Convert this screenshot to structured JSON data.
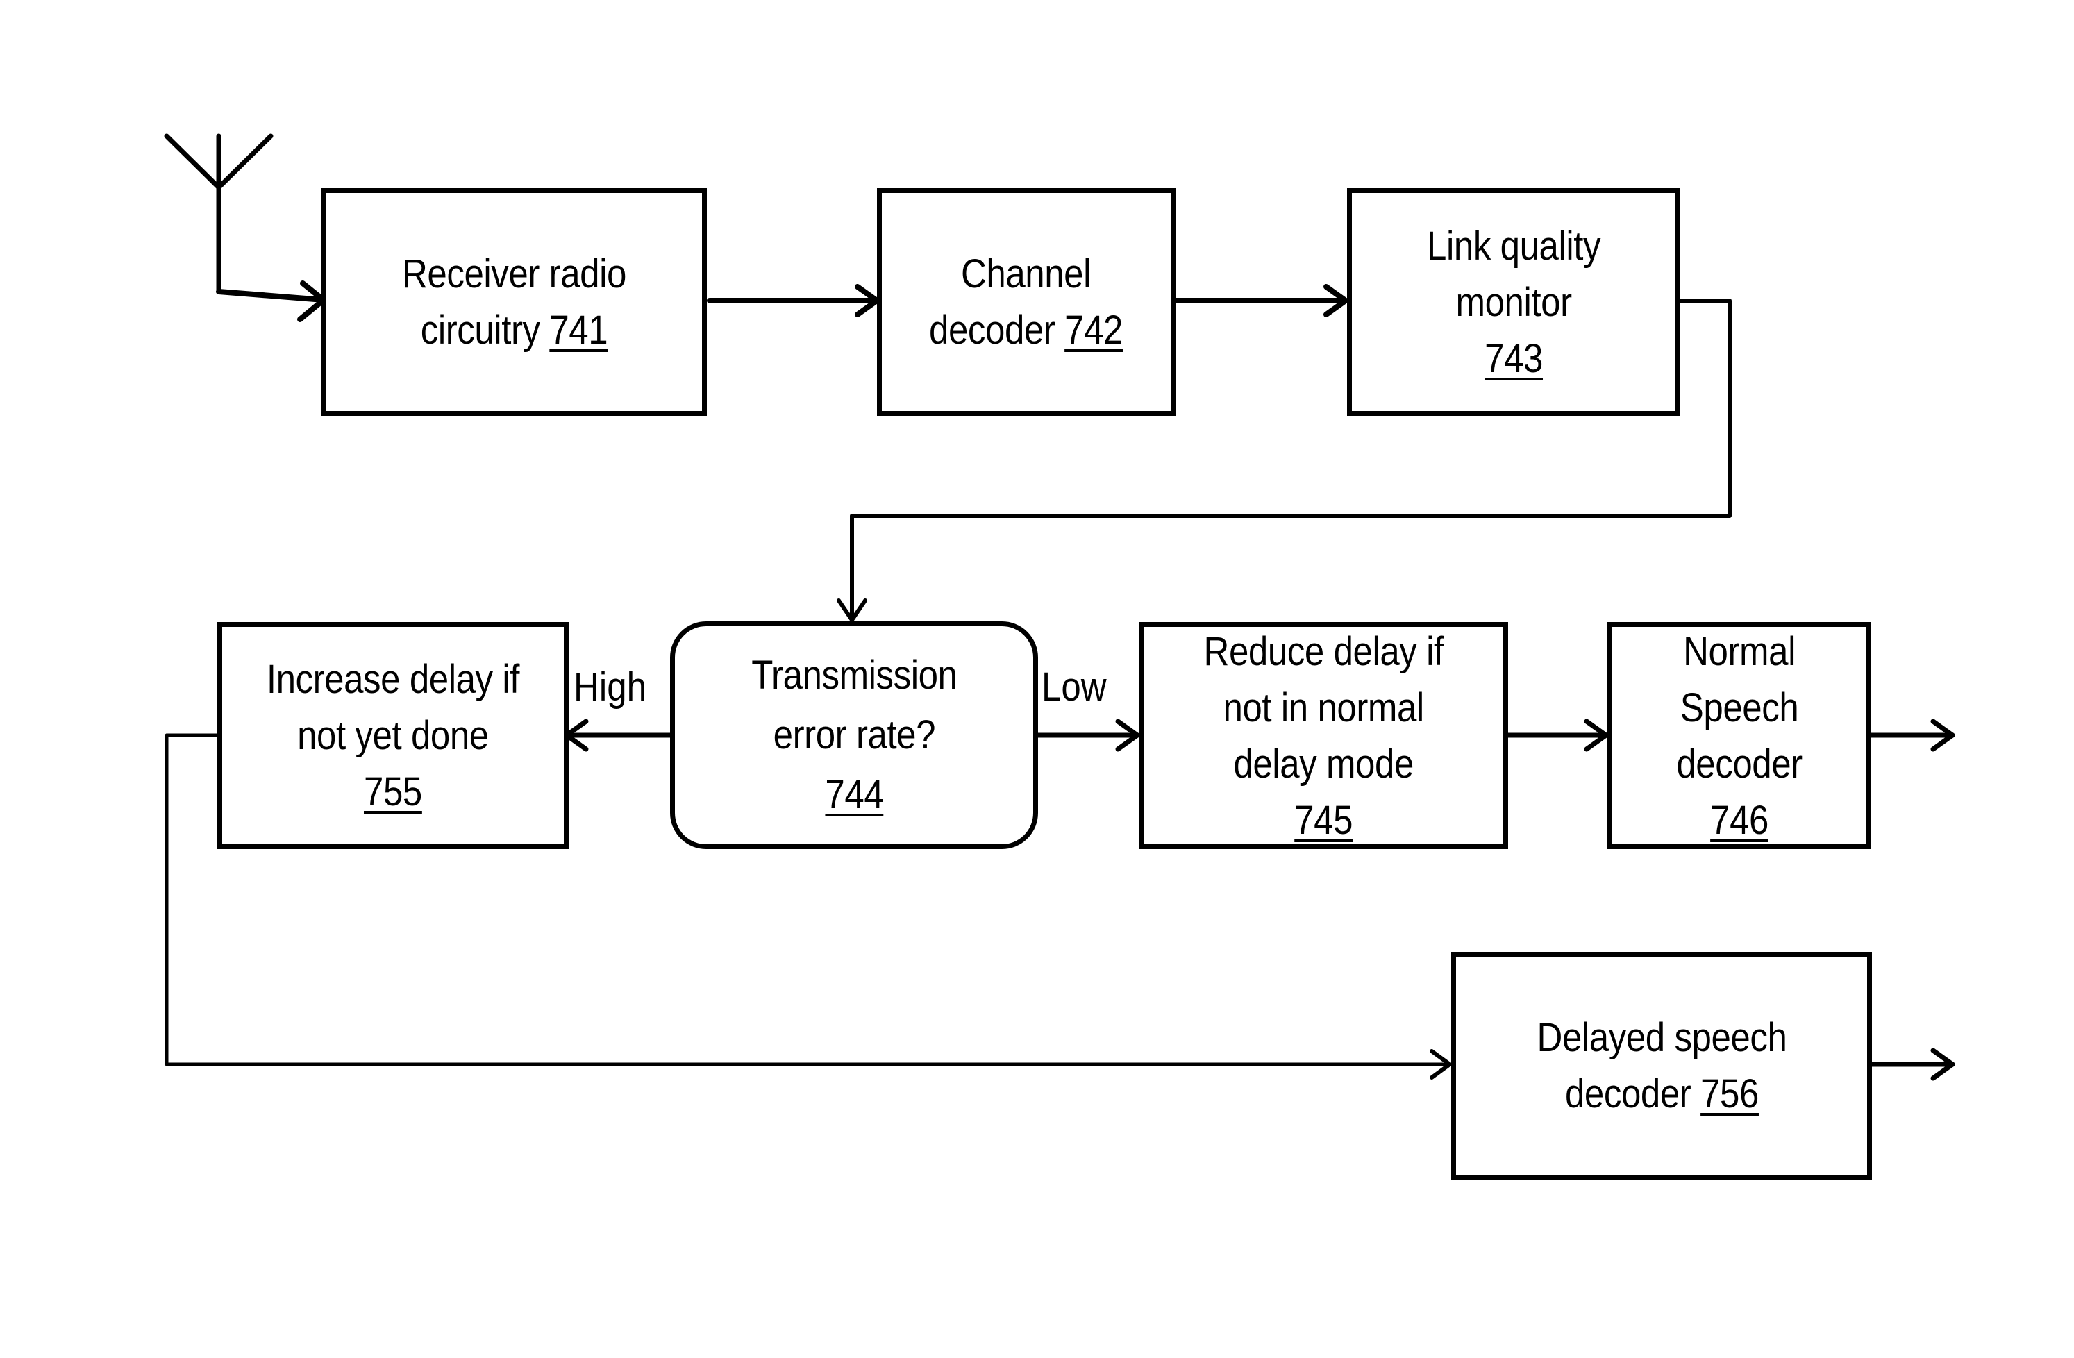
{
  "diagram": {
    "blocks": {
      "receiver": {
        "text": "Receiver radio",
        "text2": "circuitry",
        "ref": "741"
      },
      "channel": {
        "text": "Channel",
        "text2": "decoder",
        "ref": "742"
      },
      "link": {
        "line1": "Link quality",
        "line2": "monitor",
        "ref": "743"
      },
      "decision": {
        "line1": "Transmission",
        "line2": "error rate?",
        "ref": "744"
      },
      "reduce": {
        "line1": "Reduce delay if",
        "line2": "not in normal",
        "line3": "delay mode",
        "ref": "745"
      },
      "normal": {
        "line1": "Normal",
        "line2": "Speech",
        "line3": "decoder",
        "ref": "746"
      },
      "increase": {
        "line1": "Increase delay if",
        "line2": "not yet done",
        "ref": "755"
      },
      "delayed": {
        "line1": "Delayed speech",
        "line2": "decoder",
        "ref": "756"
      }
    },
    "edge_labels": {
      "high": "High",
      "low": "Low"
    },
    "icons": {
      "antenna": "antenna-icon"
    }
  }
}
